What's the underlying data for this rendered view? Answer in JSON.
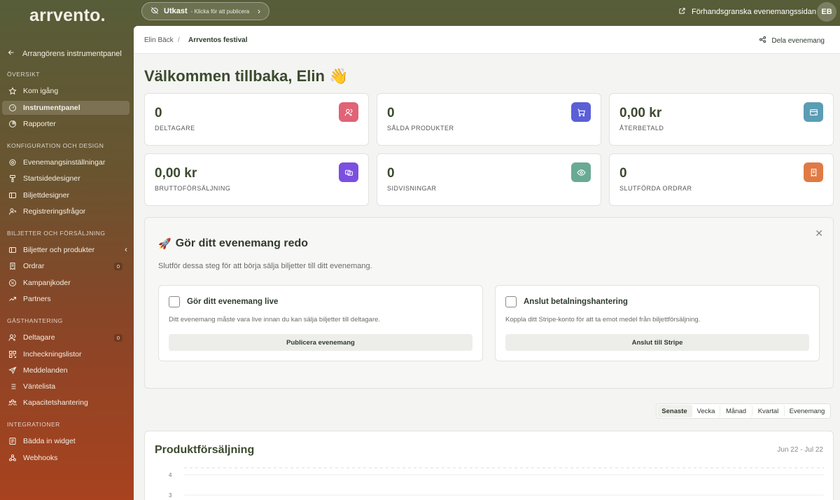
{
  "app": {
    "logo": "arrvento."
  },
  "topbar": {
    "draft_status": "Utkast",
    "draft_hint": "- Klicka för att publicera",
    "preview_label": "Förhandsgranska evenemangssidan",
    "user_initials": "EB"
  },
  "sidebar": {
    "back_label": "Arrangörens instrumentpanel",
    "sections": [
      {
        "title": "ÖVERSIKT"
      },
      {
        "title": "KONFIGURATION OCH DESIGN"
      },
      {
        "title": "BILJETTER OCH FÖRSÄLJNING"
      },
      {
        "title": "GÄSTHANTERING"
      },
      {
        "title": "INTEGRATIONER"
      }
    ],
    "items": [
      {
        "label": "Kom igång",
        "icon": "star-icon"
      },
      {
        "label": "Instrumentpanel",
        "icon": "gauge-icon",
        "active": true
      },
      {
        "label": "Rapporter",
        "icon": "chart-pie-icon"
      },
      {
        "label": "Evenemangsinställningar",
        "icon": "settings-icon"
      },
      {
        "label": "Startsidedesigner",
        "icon": "paint-icon"
      },
      {
        "label": "Biljettdesigner",
        "icon": "ticket-icon"
      },
      {
        "label": "Registreringsfrågor",
        "icon": "user-question-icon"
      },
      {
        "label": "Biljetter och produkter",
        "icon": "ticket-icon"
      },
      {
        "label": "Ordrar",
        "icon": "receipt-icon",
        "badge": "0"
      },
      {
        "label": "Kampanjkoder",
        "icon": "discount-icon"
      },
      {
        "label": "Partners",
        "icon": "trending-icon"
      },
      {
        "label": "Deltagare",
        "icon": "users-icon",
        "badge": "0"
      },
      {
        "label": "Incheckningslistor",
        "icon": "qrcode-icon"
      },
      {
        "label": "Meddelanden",
        "icon": "send-icon"
      },
      {
        "label": "Väntelista",
        "icon": "list-icon"
      },
      {
        "label": "Kapacitetshantering",
        "icon": "users-group-icon"
      },
      {
        "label": "Bädda in widget",
        "icon": "widget-icon"
      },
      {
        "label": "Webhooks",
        "icon": "webhook-icon"
      }
    ]
  },
  "breadcrumb": {
    "organizer": "Elin Bäck",
    "separator": "/",
    "event": "Arrventos festival"
  },
  "share_label": "Dela evenemang",
  "welcome": "Välkommen tillbaka, Elin 👋",
  "stats": [
    {
      "value": "0",
      "label": "DELTAGARE",
      "color": "#e06377",
      "icon": "users-icon"
    },
    {
      "value": "0",
      "label": "SÅLDA PRODUKTER",
      "color": "#5a5fd8",
      "icon": "cart-icon"
    },
    {
      "value": "0,00 kr",
      "label": "ÅTERBETALD",
      "color": "#5b9db5",
      "icon": "credit-card-refund-icon"
    },
    {
      "value": "0,00 kr",
      "label": "BRUTTOFÖRSÄLJNING",
      "color": "#7b4fe0",
      "icon": "coins-icon"
    },
    {
      "value": "0",
      "label": "SIDVISNINGAR",
      "color": "#6aaa94",
      "icon": "eye-icon"
    },
    {
      "value": "0",
      "label": "SLUTFÖRDA ORDRAR",
      "color": "#e07a45",
      "icon": "receipt-icon"
    }
  ],
  "onboarding": {
    "emoji": "🚀",
    "title": "Gör ditt evenemang redo",
    "subtitle": "Slutför dessa steg för att börja sälja biljetter till ditt evenemang.",
    "steps": [
      {
        "title": "Gör ditt evenemang live",
        "desc": "Ditt evenemang måste vara live innan du kan sälja biljetter till deltagare.",
        "button": "Publicera evenemang"
      },
      {
        "title": "Anslut betalningshantering",
        "desc": "Koppla ditt Stripe-konto för att ta emot medel från biljettförsäljning.",
        "button": "Anslut till Stripe"
      }
    ]
  },
  "period_tabs": [
    "Senaste",
    "Vecka",
    "Månad",
    "Kvartal",
    "Evenemang"
  ],
  "chart_data": {
    "type": "line",
    "title": "Produktförsäljning",
    "date_range": "Jun 22 - Jul 22",
    "y_ticks": [
      4,
      3
    ]
  }
}
